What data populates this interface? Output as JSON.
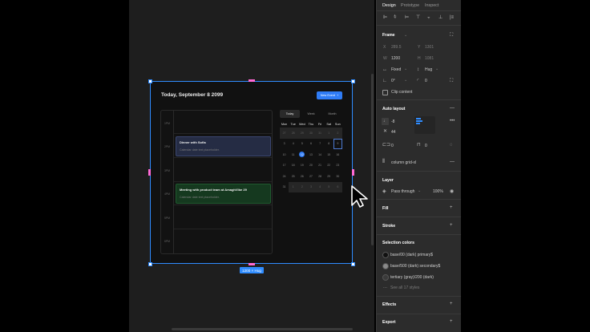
{
  "canvas": {
    "frame_title": "Today, September 8 2099",
    "new_event_label": "New Event",
    "new_event_icon": "+",
    "time_labels": [
      "1PM",
      "2PM",
      "3PM",
      "4PM",
      "5PM",
      "6PM"
    ],
    "events": [
      {
        "title": "Dinner with Sofia",
        "subtitle": "Calendar date text placeholder.",
        "color": "#252c44",
        "border": "#3a4670"
      },
      {
        "title": "Meeting with product team at AmaghVibe 29",
        "subtitle": "Calendar date text placeholder.",
        "color": "#15391f",
        "border": "#1f5a2f"
      }
    ],
    "calendar_tabs": [
      "Today",
      "Week",
      "Month"
    ],
    "active_tab": "Today",
    "weekdays": [
      "Mon",
      "Tue",
      "Wed",
      "Thu",
      "Fri",
      "Sat",
      "Sun"
    ],
    "weeks": [
      [
        "27",
        "28",
        "29",
        "30",
        "31",
        "1",
        "2"
      ],
      [
        "3",
        "4",
        "5",
        "6",
        "7",
        "8",
        "9"
      ],
      [
        "10",
        "11",
        "12",
        "13",
        "14",
        "15",
        "16"
      ],
      [
        "17",
        "18",
        "19",
        "20",
        "21",
        "22",
        "23"
      ],
      [
        "24",
        "25",
        "26",
        "27",
        "28",
        "29",
        "30"
      ],
      [
        "31",
        "1",
        "2",
        "3",
        "4",
        "5",
        "6"
      ]
    ],
    "today": "12",
    "size_tag": "1200 × Hug"
  },
  "panel": {
    "tabs": [
      "Design",
      "Prototype",
      "Inspect"
    ],
    "active_tab": "Design",
    "frame": {
      "title": "Frame",
      "x_label": "X",
      "x_value": "289.5",
      "y_label": "Y",
      "y_value": "1301",
      "w_label": "W",
      "w_value": "1200",
      "h_label": "H",
      "h_value": "1081",
      "width_mode": "Fixed",
      "height_mode": "Hug",
      "rotation": "0°",
      "radius": "0",
      "clip_content": "Clip content"
    },
    "auto_layout": {
      "title": "Auto layout",
      "spacing_vertical": "-8",
      "gap": "44",
      "pad_left": "0",
      "pad_top": "0",
      "grid": "column grid-xl"
    },
    "layer": {
      "title": "Layer",
      "mode": "Pass through",
      "opacity": "100%"
    },
    "fill_title": "Fill",
    "stroke_title": "Stroke",
    "selection_colors": {
      "title": "Selection colors",
      "items": [
        {
          "name": "base/00 (dark) primary$",
          "color": "#111111"
        },
        {
          "name": "base/500 (dark) secondary$",
          "color": "#8a8a8a"
        },
        {
          "name": "tertiary (gray)/200 (dark)",
          "color": "#3a3a3a"
        }
      ],
      "see_all": "See all 17 styles"
    },
    "effects_title": "Effects",
    "export_title": "Export"
  }
}
